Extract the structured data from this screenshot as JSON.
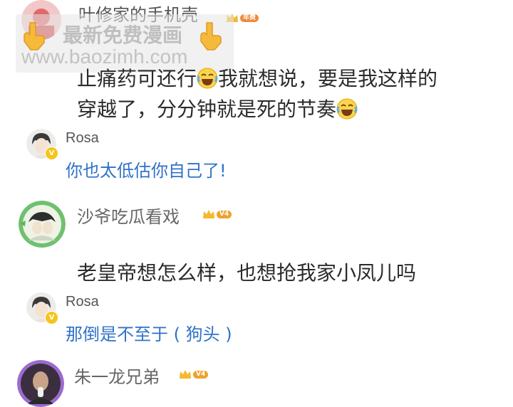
{
  "comment1": {
    "username": "叶修家的手机壳",
    "text_line1_a": "止痛药可还行",
    "text_line1_b": "我就想说，要是我这样的",
    "text_line2": "穿越了，分分钟就是死的节奏",
    "emoji": "laugh-cry-icon"
  },
  "reply1": {
    "username": "Rosa",
    "text": "你也太低估你自己了!"
  },
  "comment2": {
    "username": "沙爷吃瓜看戏",
    "level": "V4",
    "text": "老皇帝想怎么样，也想抢我家小凤儿吗"
  },
  "reply2": {
    "username": "Rosa",
    "text": "那倒是不至于 ( 狗头 )"
  },
  "comment3": {
    "username": "朱一龙兄弟",
    "level": "V4"
  },
  "watermark": {
    "line1": "最新免费漫画",
    "line2": "www.baozimh.com"
  },
  "colors": {
    "reply_blue": "#2f72c9",
    "badge_gold": "#f0a12a",
    "text_dark": "#2b2b2b",
    "username_gray": "#666666"
  }
}
